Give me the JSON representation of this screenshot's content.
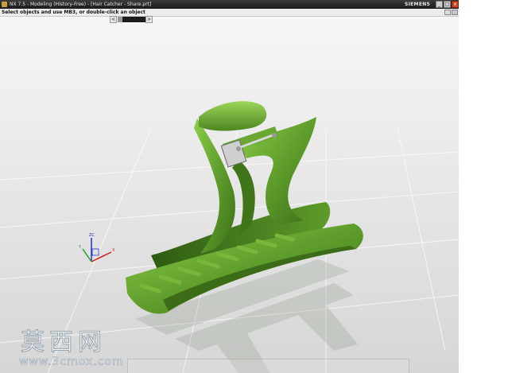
{
  "window": {
    "title": "NX 7.5 - Modeling (History-Free) - [Hair Catcher - Share.prt]",
    "brand": "SIEMENS",
    "controls": {
      "minimize": "_",
      "maximize": "□",
      "close": "x"
    }
  },
  "cue_line": {
    "text": "Select objects and use MB3, or double-click an object"
  },
  "scroll": {
    "left": "<",
    "right": ">"
  },
  "viewport": {
    "model": "hair-catcher",
    "model_color": "#5f9e2c",
    "triad_labels": {
      "x": "X",
      "y": "Y",
      "z": "ZC"
    }
  },
  "watermark": {
    "cn": "莫西网",
    "url": "www.3cmox.com"
  }
}
